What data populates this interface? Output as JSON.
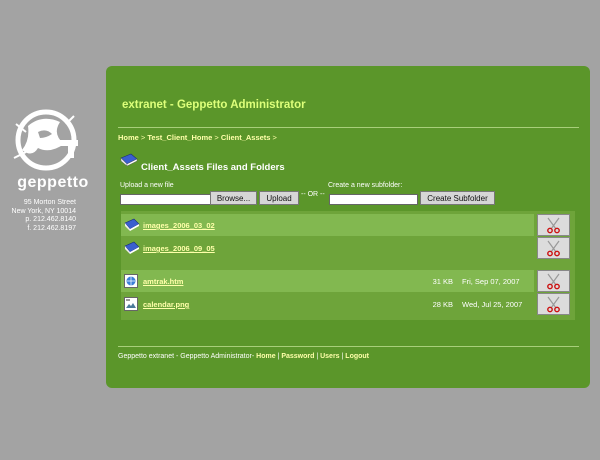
{
  "brand": "geppetto",
  "address": [
    "95 Morton Street",
    "New York, NY 10014",
    "p. 212.462.8140",
    "f. 212.462.8197"
  ],
  "header": {
    "title": "extranet - Geppetto Administrator"
  },
  "breadcrumb": {
    "home": "Home",
    "sep": " > ",
    "client_home": "Test_Client_Home",
    "client_assets": "Client_Assets",
    "trail_end": " >"
  },
  "section_title": "Client_Assets Files and Folders",
  "upload": {
    "label": "Upload a new file",
    "value": "",
    "browse_label": "Browse...",
    "upload_label": "Upload"
  },
  "or_label": "-- OR --",
  "subfolder": {
    "label": "Create a new subfolder:",
    "value": "",
    "button_label": "Create Subfolder"
  },
  "folders": [
    {
      "name": "images_2006_03_02"
    },
    {
      "name": "images_2006_09_05"
    }
  ],
  "files": [
    {
      "name": "amtrak.htm",
      "size": "31 KB",
      "date": "Fri, Sep 07, 2007",
      "icon": "web-page-icon"
    },
    {
      "name": "calendar.png",
      "size": "28 KB",
      "date": "Wed, Jul 25, 2007",
      "icon": "image-file-icon"
    }
  ],
  "footer": {
    "prefix": "Geppetto extranet - Geppetto Administrator- ",
    "home": "Home",
    "sep": " | ",
    "password": "Password",
    "users": "Users",
    "logout": "Logout"
  },
  "colors": {
    "panel": "#5b962a",
    "title": "#ddff7a",
    "link": "#ffffaa",
    "background": "#a3a3a3"
  }
}
